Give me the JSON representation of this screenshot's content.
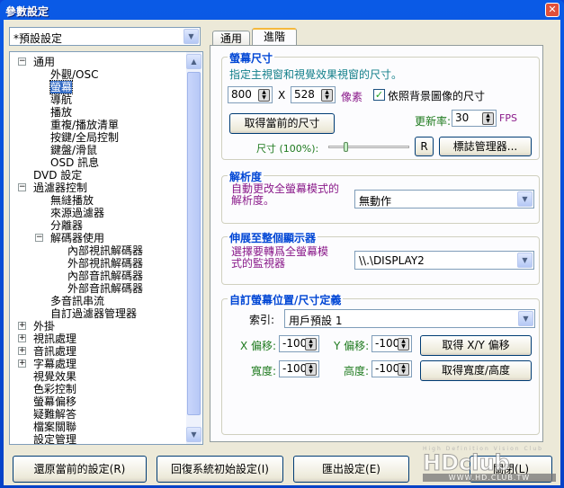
{
  "window": {
    "title": "參數設定",
    "close_label": "✕"
  },
  "preset_combo": {
    "value": "*預設設定"
  },
  "tree": [
    {
      "label": "通用",
      "level": 0,
      "exp": "-"
    },
    {
      "label": "外觀/OSC",
      "level": 1
    },
    {
      "label": "螢幕",
      "level": 1,
      "selected": true
    },
    {
      "label": "導航",
      "level": 1
    },
    {
      "label": "播放",
      "level": 1
    },
    {
      "label": "重複/播放清單",
      "level": 1
    },
    {
      "label": "按鍵/全局控制",
      "level": 1
    },
    {
      "label": "鍵盤/滑鼠",
      "level": 1
    },
    {
      "label": "OSD 訊息",
      "level": 1
    },
    {
      "label": "DVD 設定",
      "level": 0
    },
    {
      "label": "過濾器控制",
      "level": 0,
      "exp": "-"
    },
    {
      "label": "無縫播放",
      "level": 1
    },
    {
      "label": "來源過濾器",
      "level": 1
    },
    {
      "label": "分離器",
      "level": 1
    },
    {
      "label": "解碼器使用",
      "level": 1,
      "exp": "-"
    },
    {
      "label": "內部視訊解碼器",
      "level": 2
    },
    {
      "label": "外部視訊解碼器",
      "level": 2
    },
    {
      "label": "內部音訊解碼器",
      "level": 2
    },
    {
      "label": "外部音訊解碼器",
      "level": 2
    },
    {
      "label": "多音訊串流",
      "level": 1
    },
    {
      "label": "自訂過濾器管理器",
      "level": 1
    },
    {
      "label": "外掛",
      "level": 0,
      "exp": "+"
    },
    {
      "label": "視訊處理",
      "level": 0,
      "exp": "+"
    },
    {
      "label": "音訊處理",
      "level": 0,
      "exp": "+"
    },
    {
      "label": "字幕處理",
      "level": 0,
      "exp": "+"
    },
    {
      "label": "視覺效果",
      "level": 0
    },
    {
      "label": "色彩控制",
      "level": 0
    },
    {
      "label": "螢幕偏移",
      "level": 0
    },
    {
      "label": "疑難解答",
      "level": 0
    },
    {
      "label": "檔案關聯",
      "level": 0
    },
    {
      "label": "設定管理",
      "level": 0
    }
  ],
  "tabs": [
    {
      "label": "通用"
    },
    {
      "label": "進階",
      "active": true
    }
  ],
  "screen_size": {
    "title": "螢幕尺寸",
    "desc": "指定主視窗和視覺效果視窗的尺寸。",
    "width": "800",
    "x_label": "X",
    "height": "528",
    "unit": "像素",
    "follow_bg_label": "依照背景圖像的尺寸",
    "follow_bg_checked": true,
    "get_current_label": "取得當前的尺寸",
    "refresh_label": "更新率:",
    "refresh_value": "30",
    "fps_label": "FPS",
    "size_label": "尺寸 (100%):",
    "size_percent": 100,
    "r_label": "R",
    "logo_manager_label": "標誌管理器..."
  },
  "resolution": {
    "title": "解析度",
    "desc": "自動更改全螢幕模式的解析度。",
    "value": "無動作"
  },
  "stretch": {
    "title": "伸展至整個顯示器",
    "desc": "選擇要轉爲全螢幕模式的監視器",
    "value": "\\\\.\\DISPLAY2"
  },
  "custom": {
    "title": "自訂螢幕位置/尺寸定義",
    "index_label": "索引:",
    "index_value": "用戶預設 1",
    "x_offset_label": "X 偏移:",
    "x_offset": "-100",
    "y_offset_label": "Y 偏移:",
    "y_offset": "-100",
    "get_xy_label": "取得 X/Y 偏移",
    "width_label": "寬度:",
    "width": "-100",
    "height_label": "高度:",
    "height": "-100",
    "get_wh_label": "取得寬度/高度"
  },
  "footer": {
    "restore_label": "還原當前的設定(R)",
    "reset_label": "回復系統初始設定(I)",
    "export_label": "匯出設定(E)",
    "close_label": "關閉(L)"
  },
  "watermark": {
    "top": "High Definition Vision Club",
    "logo": "HDclub",
    "url": "WWW.HD.CLUB.TW"
  }
}
